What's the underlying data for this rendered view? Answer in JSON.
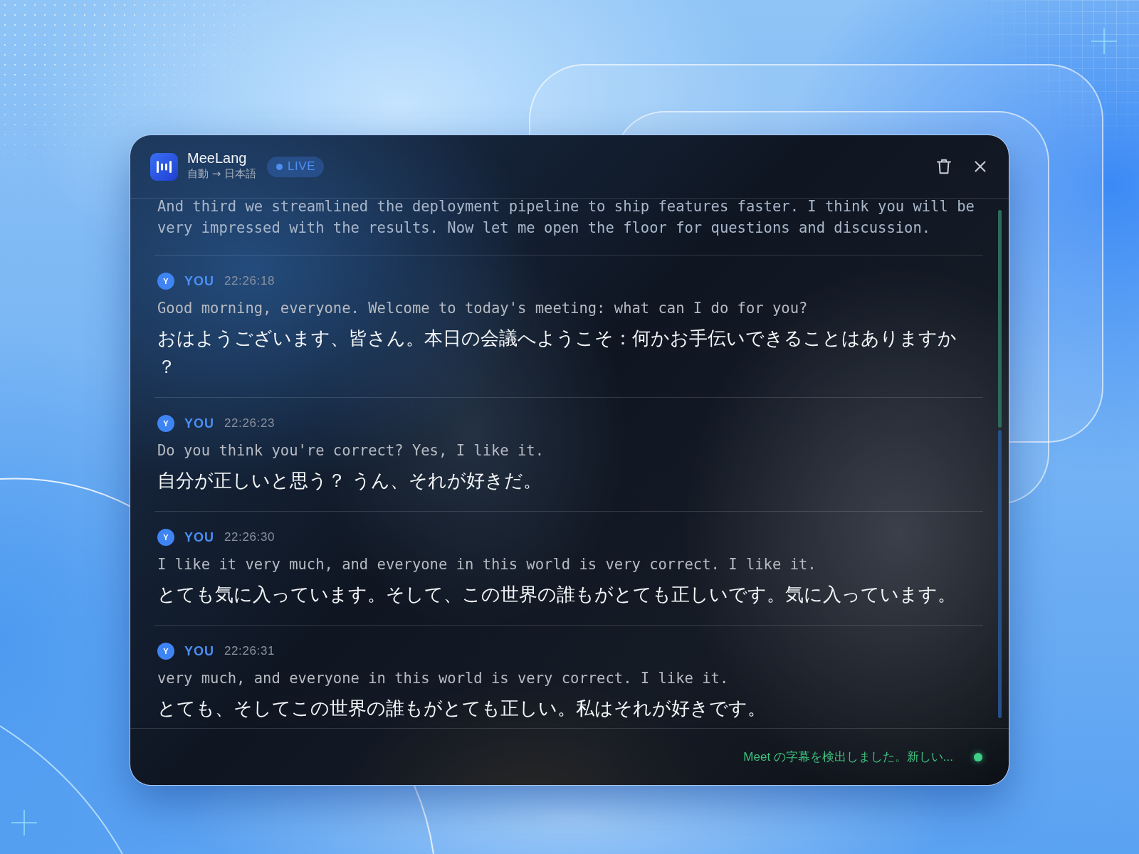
{
  "window": {
    "app_name": "MeeLang",
    "language_pair": "自動 → 日本語",
    "badge": "LIVE"
  },
  "messages": [
    {
      "original": "And third we streamlined the deployment pipeline to ship features faster. I think you will be very impressed with the results. Now let me open the floor for questions and discussion."
    },
    {
      "avatar": "Y",
      "speaker": "YOU",
      "time": "22:26:18",
      "original": "Good morning, everyone. Welcome to today's meeting: what can I do for you?",
      "translation": "おはようございます、皆さん。本日の会議へようこそ：何かお手伝いできることはありますか？"
    },
    {
      "avatar": "Y",
      "speaker": "YOU",
      "time": "22:26:23",
      "original": "Do you think you're correct? Yes, I like it.",
      "translation": "自分が正しいと思う？ うん、それが好きだ。"
    },
    {
      "avatar": "Y",
      "speaker": "YOU",
      "time": "22:26:30",
      "original": "I like it very much, and everyone in this world is very correct. I like it.",
      "translation": "とても気に入っています。そして、この世界の誰もがとても正しいです。気に入っています。"
    },
    {
      "avatar": "Y",
      "speaker": "YOU",
      "time": "22:26:31",
      "original": "very much, and everyone in this world is very correct. I like it.",
      "translation": "とても、そしてこの世界の誰もがとても正しい。私はそれが好きです。"
    }
  ],
  "status_bar": {
    "text": "Meet の字幕を検出しました。新しい...",
    "connected": true
  }
}
